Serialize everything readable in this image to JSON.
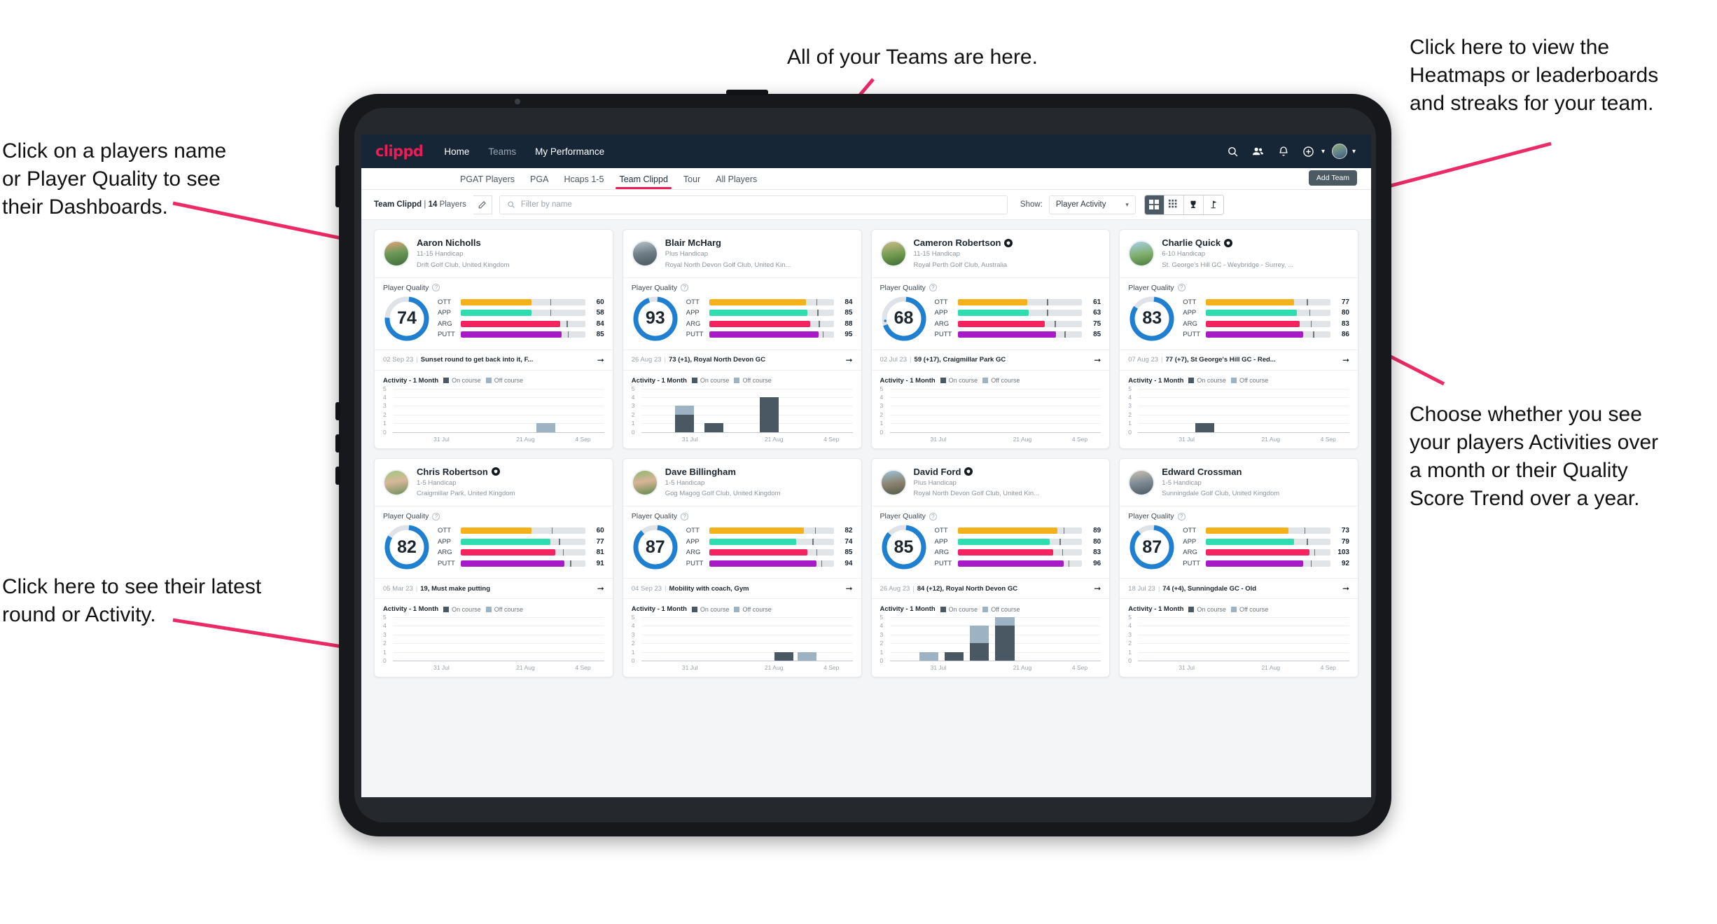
{
  "annotations": {
    "top_center": "All of your Teams are here.",
    "top_right": "Click here to view the\nHeatmaps or leaderboards\nand streaks for your team.",
    "left_1": "Click on a players name\nor Player Quality to see\ntheir Dashboards.",
    "right_2": "Choose whether you see\nyour players Activities over\na month or their Quality\nScore Trend over a year.",
    "left_2": "Click here to see their latest\nround or Activity."
  },
  "colors": {
    "accent_pink": "#ec1c55",
    "appbar": "#172637",
    "ring_blue": "#1f7fd1",
    "ott": "#f5b119",
    "app": "#2edcb0",
    "arg": "#f4225f",
    "putt": "#a61bc7",
    "on_course": "#4a5863",
    "off_course": "#9db3c4"
  },
  "appbar": {
    "brand": "clippd",
    "links": [
      {
        "label": "Home",
        "active": true
      },
      {
        "label": "Teams",
        "active": false
      },
      {
        "label": "My Performance",
        "active": true
      }
    ],
    "icons": [
      "search-icon",
      "people-icon",
      "bell-icon",
      "plus-circle-icon",
      "avatar"
    ]
  },
  "tabs": [
    {
      "label": "PGAT Players",
      "active": false
    },
    {
      "label": "PGA",
      "active": false
    },
    {
      "label": "Hcaps 1-5",
      "active": false
    },
    {
      "label": "Team Clippd",
      "active": true
    },
    {
      "label": "Tour",
      "active": false
    },
    {
      "label": "All Players",
      "active": false
    }
  ],
  "add_team_label": "Add Team",
  "filterbar": {
    "team_name": "Team Clippd",
    "separator": "|",
    "player_count": "14",
    "players_word": "Players",
    "search_placeholder": "Filter by name",
    "show_label": "Show:",
    "show_value": "Player Activity",
    "view_buttons": [
      "grid-large-icon",
      "grid-small-icon",
      "trophy-icon",
      "flag-icon"
    ]
  },
  "card_labels": {
    "player_quality": "Player Quality",
    "activity_title": "Activity - 1 Month",
    "legend_on": "On course",
    "legend_off": "Off course",
    "metrics": [
      "OTT",
      "APP",
      "ARG",
      "PUTT"
    ],
    "y_ticks": [
      "5",
      "4",
      "3",
      "2",
      "1",
      "0"
    ],
    "x_ticks": [
      "31 Jul",
      "21 Aug",
      "4 Sep"
    ]
  },
  "players": [
    {
      "name": "Aaron Nicholls",
      "verified": false,
      "handicap": "11-15 Handicap",
      "club": "Drift Golf Club, United Kingdom",
      "quality": 74,
      "metrics": [
        {
          "key": "OTT",
          "value": 60,
          "fill": 57,
          "tick": 72
        },
        {
          "key": "APP",
          "value": 58,
          "fill": 57,
          "tick": 72
        },
        {
          "key": "ARG",
          "value": 84,
          "fill": 80,
          "tick": 85
        },
        {
          "key": "PUTT",
          "value": 85,
          "fill": 81,
          "tick": 86
        }
      ],
      "round_date": "02 Sep 23",
      "round_text": "Sunset round to get back into it, F...",
      "chart_data": {
        "type": "bar",
        "title": "Activity - 1 Month",
        "categories": [
          "31 Jul",
          "21 Aug",
          "4 Sep"
        ],
        "ylim": [
          0,
          5
        ],
        "series": [
          {
            "name": "On course",
            "values": []
          },
          {
            "name": "Off course",
            "values": []
          }
        ],
        "bars": [
          {
            "pos": 68,
            "on": 0,
            "off": 1
          }
        ]
      }
    },
    {
      "name": "Blair McHarg",
      "verified": false,
      "handicap": "Plus Handicap",
      "club": "Royal North Devon Golf Club, United Kin...",
      "quality": 93,
      "metrics": [
        {
          "key": "OTT",
          "value": 84,
          "fill": 78,
          "tick": 86
        },
        {
          "key": "APP",
          "value": 85,
          "fill": 79,
          "tick": 87
        },
        {
          "key": "ARG",
          "value": 88,
          "fill": 81,
          "tick": 88
        },
        {
          "key": "PUTT",
          "value": 95,
          "fill": 88,
          "tick": 91
        }
      ],
      "round_date": "26 Aug 23",
      "round_text": "73 (+1), Royal North Devon GC",
      "chart_data": {
        "type": "bar",
        "title": "Activity - 1 Month",
        "categories": [
          "31 Jul",
          "21 Aug",
          "4 Sep"
        ],
        "ylim": [
          0,
          5
        ],
        "bars": [
          {
            "pos": 16,
            "on": 2,
            "off": 1
          },
          {
            "pos": 30,
            "on": 1,
            "off": 0
          },
          {
            "pos": 56,
            "on": 4,
            "off": 0
          }
        ]
      }
    },
    {
      "name": "Cameron Robertson",
      "verified": true,
      "handicap": "11-15 Handicap",
      "club": "Royal Perth Golf Club, Australia",
      "quality": 68,
      "metrics": [
        {
          "key": "OTT",
          "value": 61,
          "fill": 56,
          "tick": 72
        },
        {
          "key": "APP",
          "value": 63,
          "fill": 57,
          "tick": 72
        },
        {
          "key": "ARG",
          "value": 75,
          "fill": 70,
          "tick": 78
        },
        {
          "key": "PUTT",
          "value": 85,
          "fill": 79,
          "tick": 86
        }
      ],
      "round_date": "02 Jul 23",
      "round_text": "59 (+17), Craigmillar Park GC",
      "chart_data": {
        "type": "bar",
        "title": "Activity - 1 Month",
        "categories": [
          "31 Jul",
          "21 Aug",
          "4 Sep"
        ],
        "ylim": [
          0,
          5
        ],
        "bars": []
      }
    },
    {
      "name": "Charlie Quick",
      "verified": true,
      "handicap": "6-10 Handicap",
      "club": "St. George's Hill GC - Weybridge - Surrey, ...",
      "quality": 83,
      "metrics": [
        {
          "key": "OTT",
          "value": 77,
          "fill": 71,
          "tick": 81
        },
        {
          "key": "APP",
          "value": 80,
          "fill": 73,
          "tick": 83
        },
        {
          "key": "ARG",
          "value": 83,
          "fill": 75,
          "tick": 84
        },
        {
          "key": "PUTT",
          "value": 86,
          "fill": 78,
          "tick": 86
        }
      ],
      "round_date": "07 Aug 23",
      "round_text": "77 (+7), St George's Hill GC - Red...",
      "chart_data": {
        "type": "bar",
        "title": "Activity - 1 Month",
        "categories": [
          "31 Jul",
          "21 Aug",
          "4 Sep"
        ],
        "ylim": [
          0,
          5
        ],
        "bars": [
          {
            "pos": 27,
            "on": 1,
            "off": 0
          }
        ]
      }
    },
    {
      "name": "Chris Robertson",
      "verified": true,
      "handicap": "1-5 Handicap",
      "club": "Craigmillar Park, United Kingdom",
      "quality": 82,
      "metrics": [
        {
          "key": "OTT",
          "value": 60,
          "fill": 57,
          "tick": 73
        },
        {
          "key": "APP",
          "value": 77,
          "fill": 72,
          "tick": 79
        },
        {
          "key": "ARG",
          "value": 81,
          "fill": 76,
          "tick": 82
        },
        {
          "key": "PUTT",
          "value": 91,
          "fill": 83,
          "tick": 88
        }
      ],
      "round_date": "05 Mar 23",
      "round_text": "19, Must make putting",
      "chart_data": {
        "type": "bar",
        "title": "Activity - 1 Month",
        "categories": [
          "31 Jul",
          "21 Aug",
          "4 Sep"
        ],
        "ylim": [
          0,
          5
        ],
        "bars": []
      }
    },
    {
      "name": "Dave Billingham",
      "verified": false,
      "handicap": "1-5 Handicap",
      "club": "Gog Magog Golf Club, United Kingdom",
      "quality": 87,
      "metrics": [
        {
          "key": "OTT",
          "value": 82,
          "fill": 76,
          "tick": 85
        },
        {
          "key": "APP",
          "value": 74,
          "fill": 70,
          "tick": 83
        },
        {
          "key": "ARG",
          "value": 85,
          "fill": 79,
          "tick": 86
        },
        {
          "key": "PUTT",
          "value": 94,
          "fill": 86,
          "tick": 90
        }
      ],
      "round_date": "04 Sep 23",
      "round_text": "Mobility with coach, Gym",
      "chart_data": {
        "type": "bar",
        "title": "Activity - 1 Month",
        "categories": [
          "31 Jul",
          "21 Aug",
          "4 Sep"
        ],
        "ylim": [
          0,
          5
        ],
        "bars": [
          {
            "pos": 63,
            "on": 1,
            "off": 0
          },
          {
            "pos": 74,
            "on": 0,
            "off": 1
          }
        ]
      }
    },
    {
      "name": "David Ford",
      "verified": true,
      "handicap": "Plus Handicap",
      "club": "Royal North Devon Golf Club, United Kin...",
      "quality": 85,
      "metrics": [
        {
          "key": "OTT",
          "value": 89,
          "fill": 80,
          "tick": 85
        },
        {
          "key": "APP",
          "value": 80,
          "fill": 74,
          "tick": 82
        },
        {
          "key": "ARG",
          "value": 83,
          "fill": 77,
          "tick": 84
        },
        {
          "key": "PUTT",
          "value": 96,
          "fill": 85,
          "tick": 89
        }
      ],
      "round_date": "26 Aug 23",
      "round_text": "84 (+12), Royal North Devon GC",
      "chart_data": {
        "type": "bar",
        "title": "Activity - 1 Month",
        "categories": [
          "31 Jul",
          "21 Aug",
          "4 Sep"
        ],
        "ylim": [
          0,
          5
        ],
        "bars": [
          {
            "pos": 14,
            "on": 0,
            "off": 1
          },
          {
            "pos": 26,
            "on": 1,
            "off": 0
          },
          {
            "pos": 38,
            "on": 2,
            "off": 2
          },
          {
            "pos": 50,
            "on": 4,
            "off": 1
          }
        ]
      }
    },
    {
      "name": "Edward Crossman",
      "verified": false,
      "handicap": "1-5 Handicap",
      "club": "Sunningdale Golf Club, United Kingdom",
      "quality": 87,
      "metrics": [
        {
          "key": "OTT",
          "value": 73,
          "fill": 66,
          "tick": 79
        },
        {
          "key": "APP",
          "value": 79,
          "fill": 71,
          "tick": 81
        },
        {
          "key": "ARG",
          "value": 103,
          "fill": 83,
          "tick": 87
        },
        {
          "key": "PUTT",
          "value": 92,
          "fill": 78,
          "tick": 84
        }
      ],
      "round_date": "18 Jul 23",
      "round_text": "74 (+4), Sunningdale GC - Old",
      "chart_data": {
        "type": "bar",
        "title": "Activity - 1 Month",
        "categories": [
          "31 Jul",
          "21 Aug",
          "4 Sep"
        ],
        "ylim": [
          0,
          5
        ],
        "bars": []
      }
    }
  ]
}
